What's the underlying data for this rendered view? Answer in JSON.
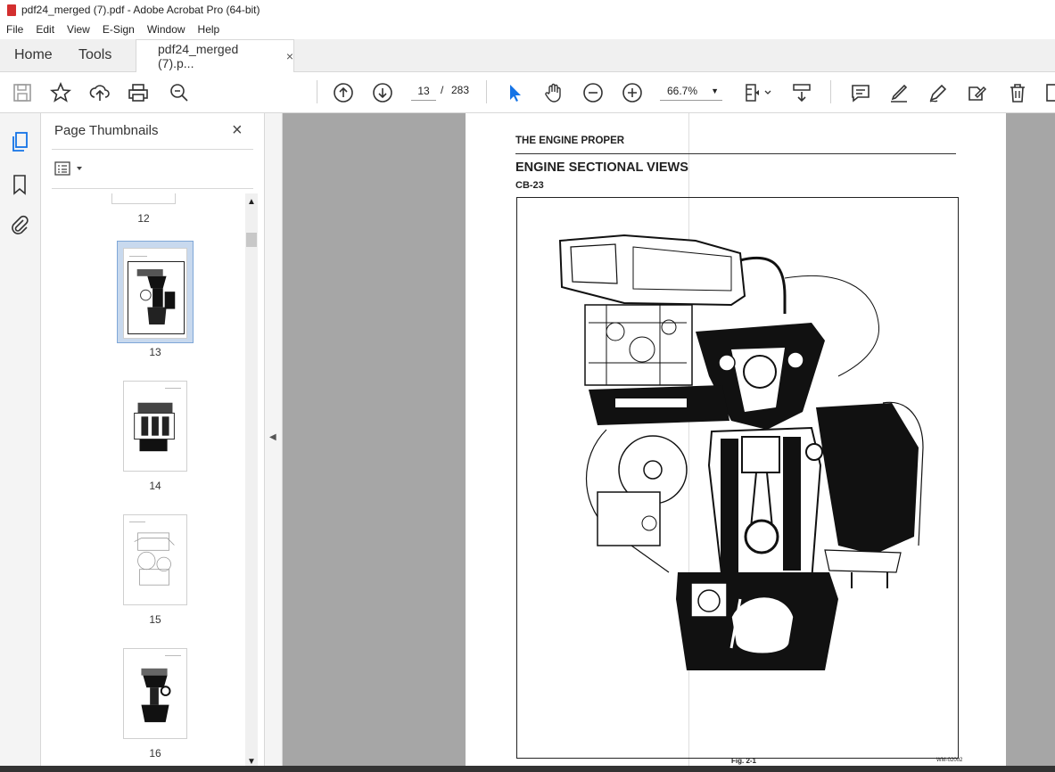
{
  "window": {
    "title": "pdf24_merged (7).pdf - Adobe Acrobat Pro (64-bit)"
  },
  "menu": [
    "File",
    "Edit",
    "View",
    "E-Sign",
    "Window",
    "Help"
  ],
  "nav": {
    "home": "Home",
    "tools": "Tools"
  },
  "doc_tab": {
    "label": "pdf24_merged (7).p...",
    "close": "×"
  },
  "toolbar": {
    "current_page": "13",
    "separator": "/",
    "total_pages": "283",
    "zoom": "66.7%",
    "icons": [
      "save-icon",
      "bookmark-star-icon",
      "upload-icon",
      "print-icon",
      "search-zoom-icon",
      "prev-page-icon",
      "next-page-icon",
      "select-cursor-icon",
      "hand-icon",
      "zoom-out-icon",
      "zoom-in-icon",
      "fit-page-icon",
      "scroll-mode-icon",
      "comment-icon",
      "highlight-icon",
      "sign-icon",
      "edit-pdf-icon",
      "delete-icon"
    ]
  },
  "panel": {
    "title": "Page Thumbnails",
    "close": "×",
    "thumbnails": [
      {
        "label": "12"
      },
      {
        "label": "13",
        "selected": true
      },
      {
        "label": "14"
      },
      {
        "label": "15"
      },
      {
        "label": "16"
      }
    ]
  },
  "page": {
    "header": "THE ENGINE PROPER",
    "title": "ENGINE SECTIONAL VIEWS",
    "subtitle": "CB-23",
    "figure": "Fig. 2-1",
    "code": "WM-02002"
  }
}
